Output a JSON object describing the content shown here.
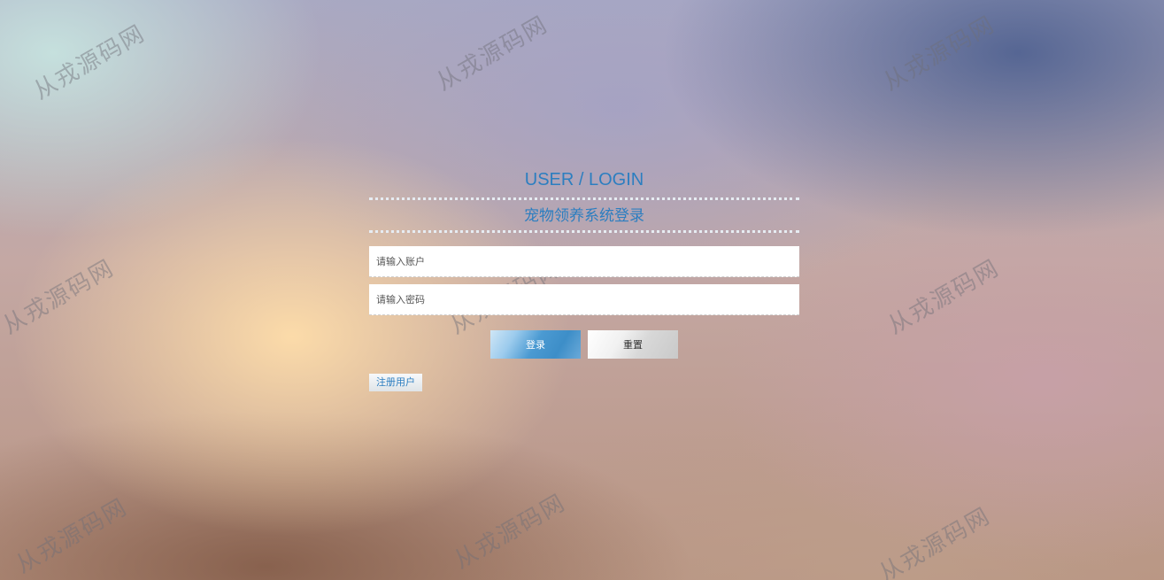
{
  "login": {
    "title_en": "USER / LOGIN",
    "title_cn": "宠物领养系统登录",
    "username_placeholder": "请输入账户",
    "password_placeholder": "请输入密码",
    "login_label": "登录",
    "reset_label": "重置",
    "register_label": "注册用户"
  },
  "watermark": {
    "text": "从戎源码网"
  },
  "colors": {
    "accent": "#2c7ec0",
    "login_button": "#4b9ad2",
    "reset_button": "#e0e0e0"
  }
}
